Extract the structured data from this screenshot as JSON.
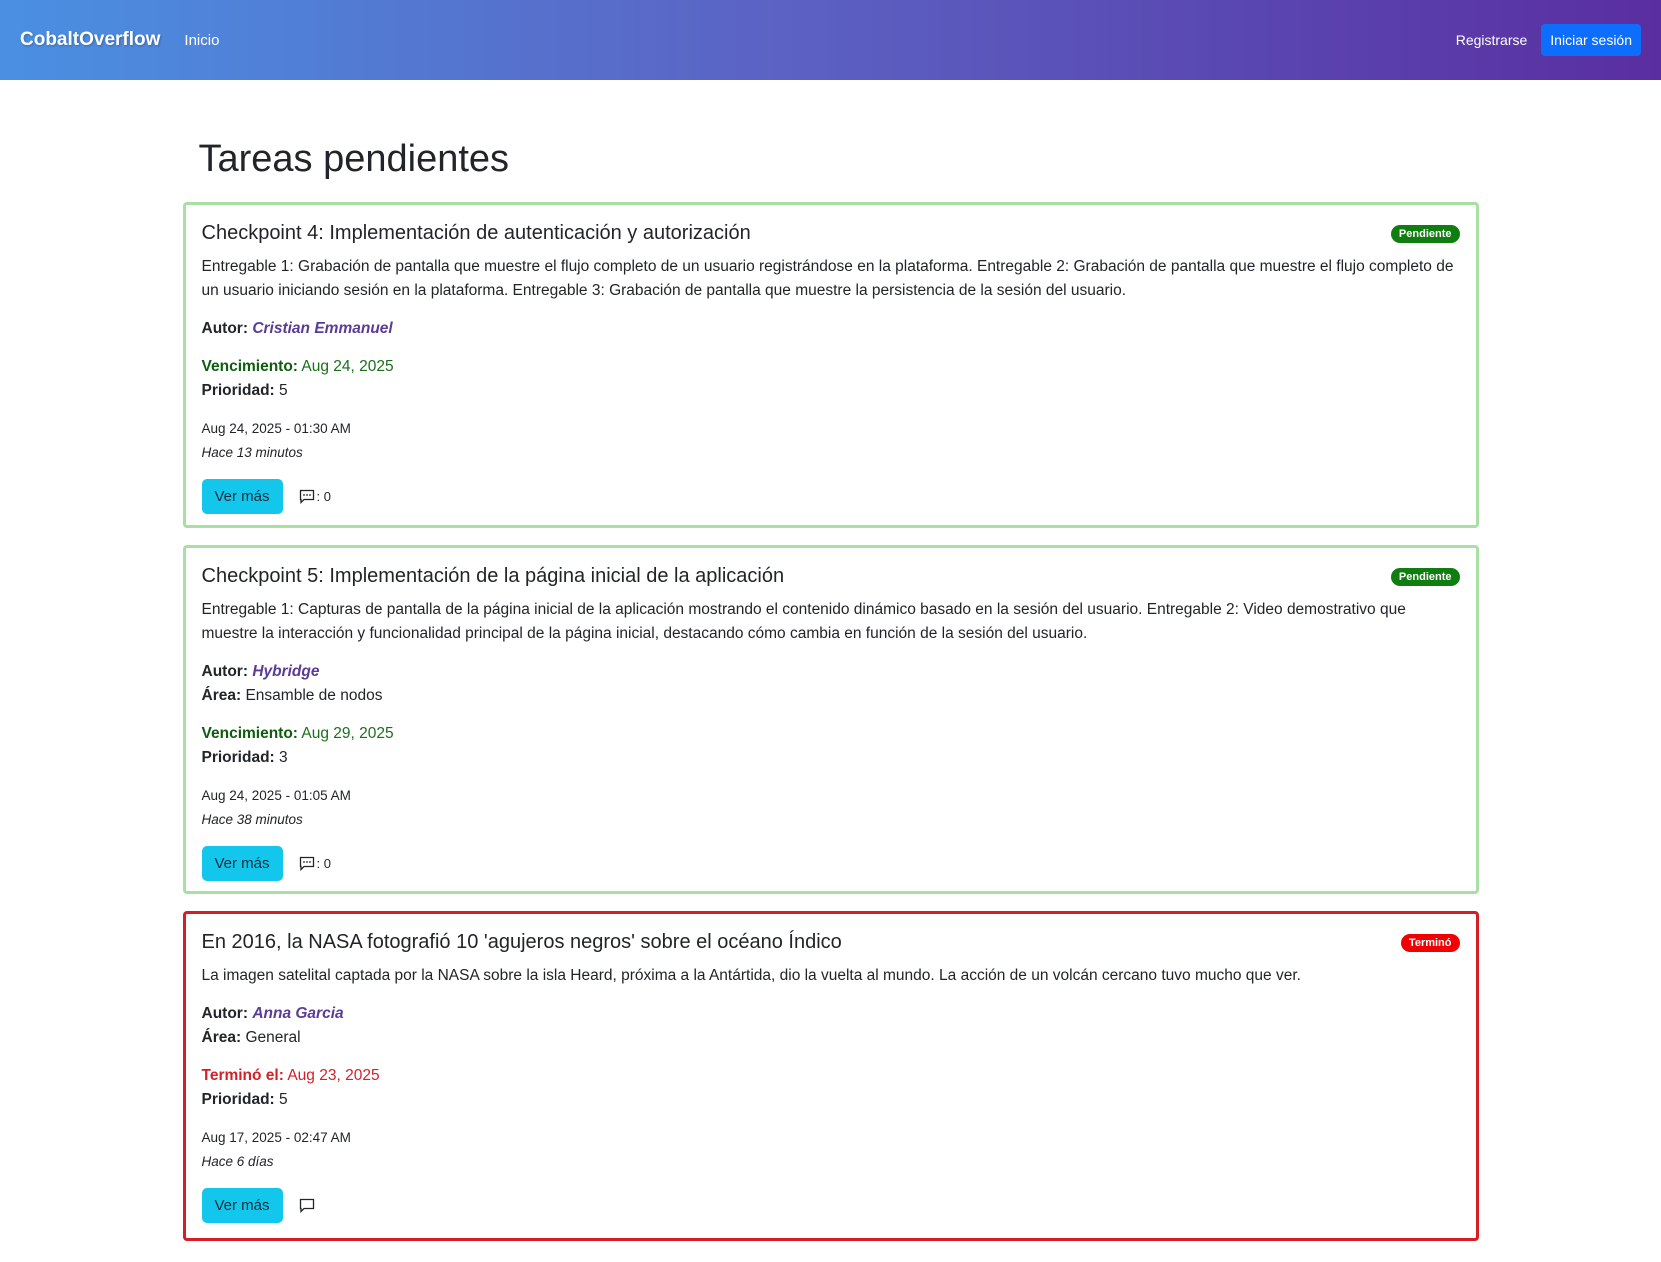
{
  "navbar": {
    "brand": "CobaltOverflow",
    "home_link": "Inicio",
    "register_link": "Registrarse",
    "login_button": "Iniciar sesión"
  },
  "page": {
    "title": "Tareas pendientes"
  },
  "labels": {
    "author": "Autor:",
    "area": "Área:",
    "due": "Vencimiento:",
    "ended": "Terminó el:",
    "priority": "Prioridad:",
    "view_more": "Ver más",
    "comments_suffix": ": 0"
  },
  "tasks": [
    {
      "title": "Checkpoint 4: Implementación de autenticación y autorización",
      "status": "Pendiente",
      "description": "Entregable 1: Grabación de pantalla que muestre el flujo completo de un usuario registrándose en la plataforma. Entregable 2: Grabación de pantalla que muestre el flujo completo de un usuario iniciando sesión en la plataforma. Entregable 3: Grabación de pantalla que muestre la persistencia de la sesión del usuario.",
      "author": "Cristian Emmanuel",
      "due": "Aug 24, 2025",
      "priority": "5",
      "created": "Aug 24, 2025 - 01:30 AM",
      "ago": "Hace 13 minutos",
      "comments": "0"
    },
    {
      "title": "Checkpoint 5: Implementación de la página inicial de la aplicación",
      "status": "Pendiente",
      "description": "Entregable 1: Capturas de pantalla de la página inicial de la aplicación mostrando el contenido dinámico basado en la sesión del usuario. Entregable 2: Video demostrativo que muestre la interacción y funcionalidad principal de la página inicial, destacando cómo cambia en función de la sesión del usuario.",
      "author": "Hybridge",
      "area": "Ensamble de nodos",
      "due": "Aug 29, 2025",
      "priority": "3",
      "created": "Aug 24, 2025 - 01:05 AM",
      "ago": "Hace 38 minutos",
      "comments": "0"
    },
    {
      "title": "En 2016, la NASA fotografió 10 'agujeros negros' sobre el océano Índico",
      "status": "Terminó",
      "description": "La imagen satelital captada por la NASA sobre la isla Heard, próxima a la Antártida, dio la vuelta al mundo. La acción de un volcán cercano tuvo mucho que ver.",
      "author": "Anna Garcia",
      "area": "General",
      "ended": "Aug 23, 2025",
      "priority": "5",
      "created": "Aug 17, 2025 - 02:47 AM",
      "ago": "Hace 6 días"
    }
  ],
  "colors": {
    "pending_border": "#a8e0a3",
    "done_border": "#d51f26",
    "pending_badge": "#0f7d0f",
    "done_badge": "#f00000",
    "view_more_button": "#13c7ec",
    "login_button": "#0d6efd"
  }
}
